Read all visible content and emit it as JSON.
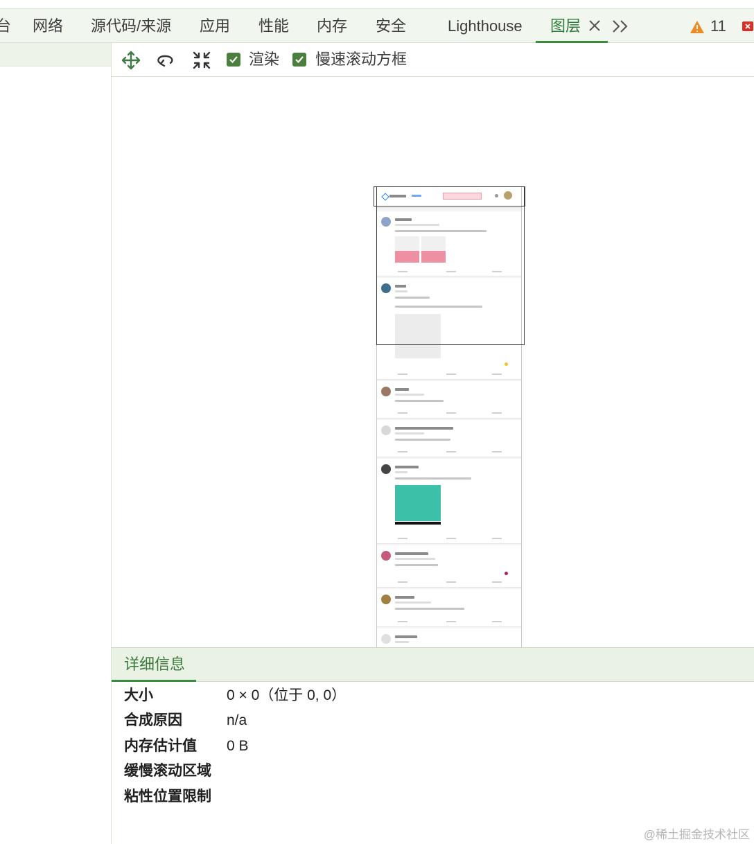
{
  "tabs": [
    {
      "label": "台"
    },
    {
      "label": "网络"
    },
    {
      "label": "源代码/来源"
    },
    {
      "label": "应用"
    },
    {
      "label": "性能"
    },
    {
      "label": "内存"
    },
    {
      "label": "安全"
    },
    {
      "label": "Lighthouse"
    },
    {
      "label": "图层",
      "active": true
    }
  ],
  "issues": {
    "warning_count": "11"
  },
  "toolbar": {
    "checkboxes": [
      {
        "label": "渲染",
        "checked": true
      },
      {
        "label": "慢速滚动方框",
        "checked": true
      }
    ]
  },
  "icons": [
    "pan-move-icon",
    "rotate-icon",
    "reset-view-icon",
    "close-icon",
    "more-tabs-icon",
    "warning-icon",
    "error-icon",
    "checkbox-check-icon"
  ],
  "colors": {
    "accent": "#3d8b40",
    "checkbox": "#4b7f3e",
    "warning": "#f08a24",
    "error": "#d93025",
    "tabbar": "#f1f6ee"
  },
  "details": {
    "tab_label": "详细信息",
    "rows": [
      {
        "key": "大小",
        "value": "0 × 0（位于 0, 0）"
      },
      {
        "key": "合成原因",
        "value": "n/a"
      },
      {
        "key": "内存估计值",
        "value": "0 B"
      },
      {
        "key": "缓慢滚动区域",
        "value": ""
      },
      {
        "key": "粘性位置限制",
        "value": ""
      }
    ]
  },
  "watermark": "@稀土掘金技术社区"
}
